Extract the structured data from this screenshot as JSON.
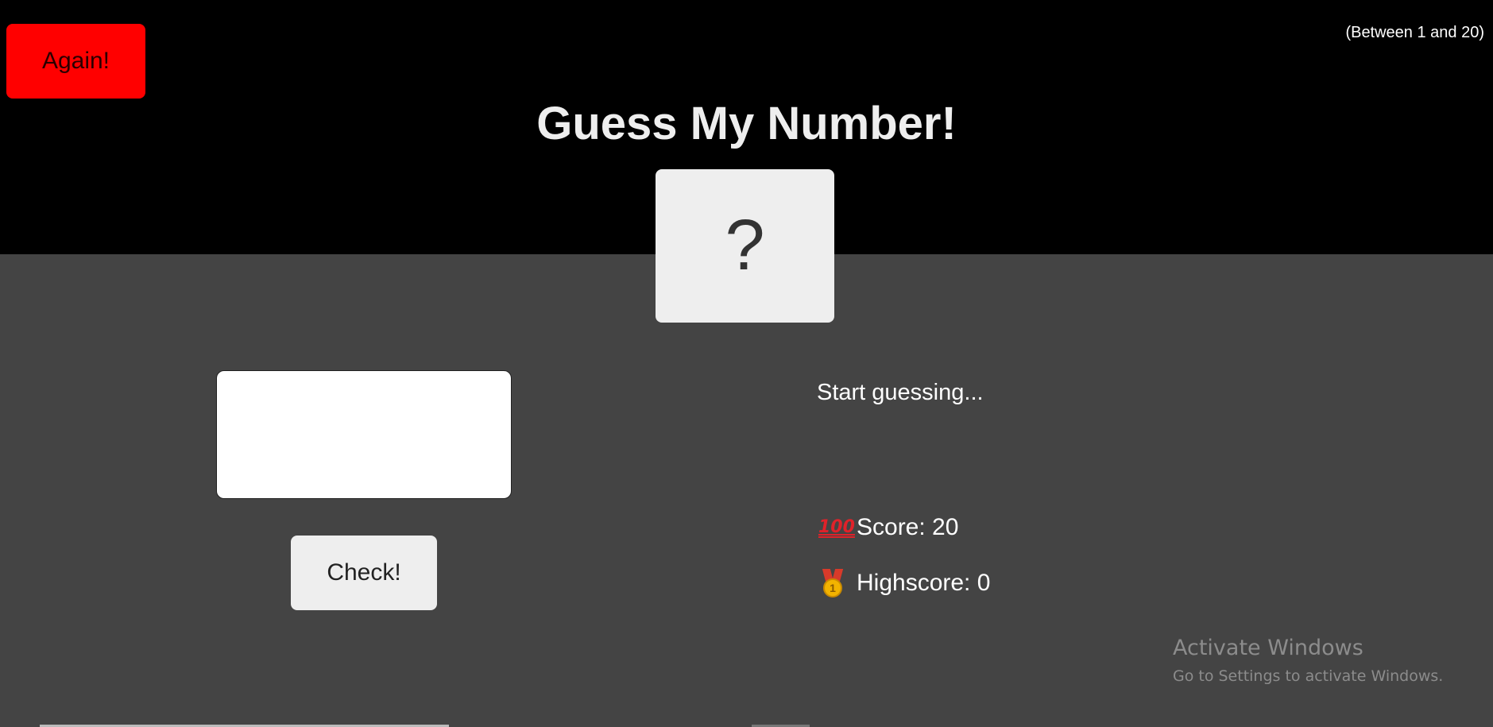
{
  "header": {
    "again_label": "Again!",
    "range_hint": "(Between 1 and 20)",
    "title": "Guess My Number!",
    "secret_number": "?"
  },
  "controls": {
    "guess_value": "",
    "check_label": "Check!"
  },
  "status": {
    "message": "Start guessing...",
    "score_icon": "hundred-points-icon",
    "score_label": "Score: 20",
    "highscore_icon": "medal-icon",
    "highscore_label": "Highscore: 0"
  },
  "watermark": {
    "title": "Activate Windows",
    "subtitle": "Go to Settings to activate Windows."
  },
  "colors": {
    "header_bg": "#000000",
    "body_bg": "#444444",
    "again_button": "#ff0000",
    "number_box": "#eeeeee"
  }
}
